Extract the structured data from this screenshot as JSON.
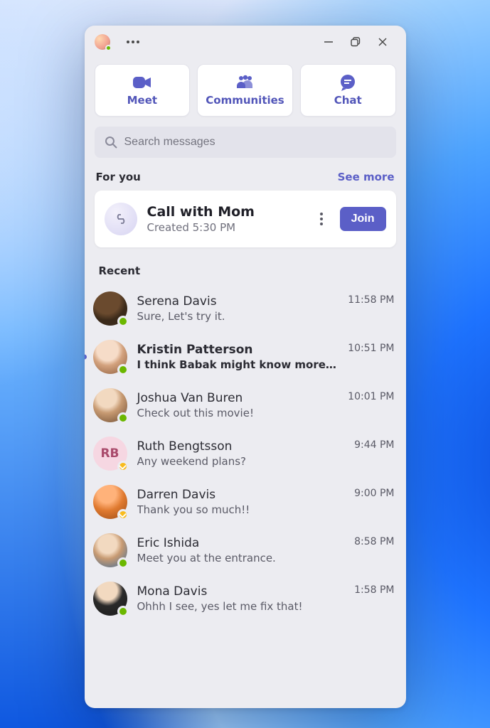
{
  "titlebar": {
    "me_presence": "online"
  },
  "tabs": [
    {
      "icon": "meet",
      "label": "Meet"
    },
    {
      "icon": "communities",
      "label": "Communities"
    },
    {
      "icon": "chat",
      "label": "Chat"
    }
  ],
  "search": {
    "placeholder": "Search messages"
  },
  "for_you": {
    "heading": "For you",
    "see_more": "See more",
    "card": {
      "title": "Call with Mom",
      "subtitle": "Created 5:30 PM",
      "join_label": "Join"
    }
  },
  "recent": {
    "heading": "Recent",
    "items": [
      {
        "name": "Serena Davis",
        "preview": "Sure, Let's try it.",
        "time": "11:58 PM",
        "presence": "online",
        "unread": false,
        "initials": ""
      },
      {
        "name": "Kristin Patterson",
        "preview": "I think Babak might know more a…",
        "time": "10:51 PM",
        "presence": "online",
        "unread": true,
        "initials": ""
      },
      {
        "name": "Joshua Van Buren",
        "preview": "Check out this movie!",
        "time": "10:01 PM",
        "presence": "online",
        "unread": false,
        "initials": ""
      },
      {
        "name": "Ruth Bengtsson",
        "preview": "Any weekend plans?",
        "time": "9:44 PM",
        "presence": "away",
        "unread": false,
        "initials": "RB"
      },
      {
        "name": "Darren Davis",
        "preview": "Thank you so much!!",
        "time": "9:00 PM",
        "presence": "away",
        "unread": false,
        "initials": ""
      },
      {
        "name": "Eric Ishida",
        "preview": "Meet you at the entrance.",
        "time": "8:58 PM",
        "presence": "online",
        "unread": false,
        "initials": ""
      },
      {
        "name": "Mona Davis",
        "preview": "Ohhh I see, yes let me fix that!",
        "time": "1:58 PM",
        "presence": "online",
        "unread": false,
        "initials": ""
      }
    ]
  }
}
